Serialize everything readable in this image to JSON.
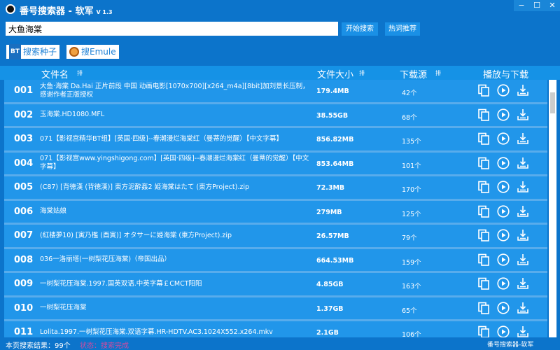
{
  "window": {
    "title": "番号搜索器 - 软军",
    "version": "V 1.3",
    "minimize": "−",
    "maximize": "☐",
    "close": "✕"
  },
  "search": {
    "value": "大鱼海棠",
    "start_label": "开始搜索",
    "hot_label": "热词推荐"
  },
  "tools": {
    "bt_badge": "BT",
    "seed_label": "搜索种子",
    "emule_label": "搜Emule"
  },
  "header": {
    "name": "文件名",
    "size": "文件大小",
    "sources": "下载源",
    "actions": "播放与下载",
    "sort": "排"
  },
  "rows": [
    {
      "num": "001",
      "name": "大鱼·海棠 Da.Hai 正片前段 中国 动画电影[1070x700][x264_m4a][8bit]加刘景长压制，感谢作者正版授权",
      "size": "179.4MB",
      "src": "42个"
    },
    {
      "num": "002",
      "name": "玉海棠.HD1080.MFL",
      "size": "38.55GB",
      "src": "68个"
    },
    {
      "num": "003",
      "name": "071【影视宫精华BT组】[英国·四级]--春潮漫烂海棠红（曼蒂的觉醒）【中文字幕】",
      "size": "856.82MB",
      "src": "135个"
    },
    {
      "num": "004",
      "name": "071【影视宫www.yingshigong.com】[英国·四级]--春潮漫烂海棠红（曼蒂的觉醒）【中文字幕】",
      "size": "853.64MB",
      "src": "101个"
    },
    {
      "num": "005",
      "name": "(C87) [背徳漢 (背徳漢)] 東方泥酔姦2 姫海棠はたて (東方Project).zip",
      "size": "72.3MB",
      "src": "170个"
    },
    {
      "num": "006",
      "name": "海棠姑娘",
      "size": "279MB",
      "src": "125个"
    },
    {
      "num": "007",
      "name": "(紅楼夢10) [寅乃檻 (酉寅)] オタサーに姫海棠 (東方Project).zip",
      "size": "26.57MB",
      "src": "79个"
    },
    {
      "num": "008",
      "name": "036一洛丽塔(一树梨花压海棠)（帝国出品）",
      "size": "664.53MB",
      "src": "159个"
    },
    {
      "num": "009",
      "name": "一树梨花压海棠.1997.国英双语.中英字幕￡CMCT阳阳",
      "size": "4.85GB",
      "src": "163个"
    },
    {
      "num": "010",
      "name": "一树梨花压海棠",
      "size": "1.37GB",
      "src": "65个"
    },
    {
      "num": "011",
      "name": "Lolita.1997.一树梨花压海棠.双语字幕.HR-HDTV.AC3.1024X552.x264.mkv",
      "size": "2.1GB",
      "src": "106个"
    }
  ],
  "status": {
    "results": "本页搜索结果：99个",
    "state": "状态：搜索完成",
    "watermark": "番号搜索器-软军"
  },
  "colors": {
    "status_state": "#d04aa0"
  }
}
